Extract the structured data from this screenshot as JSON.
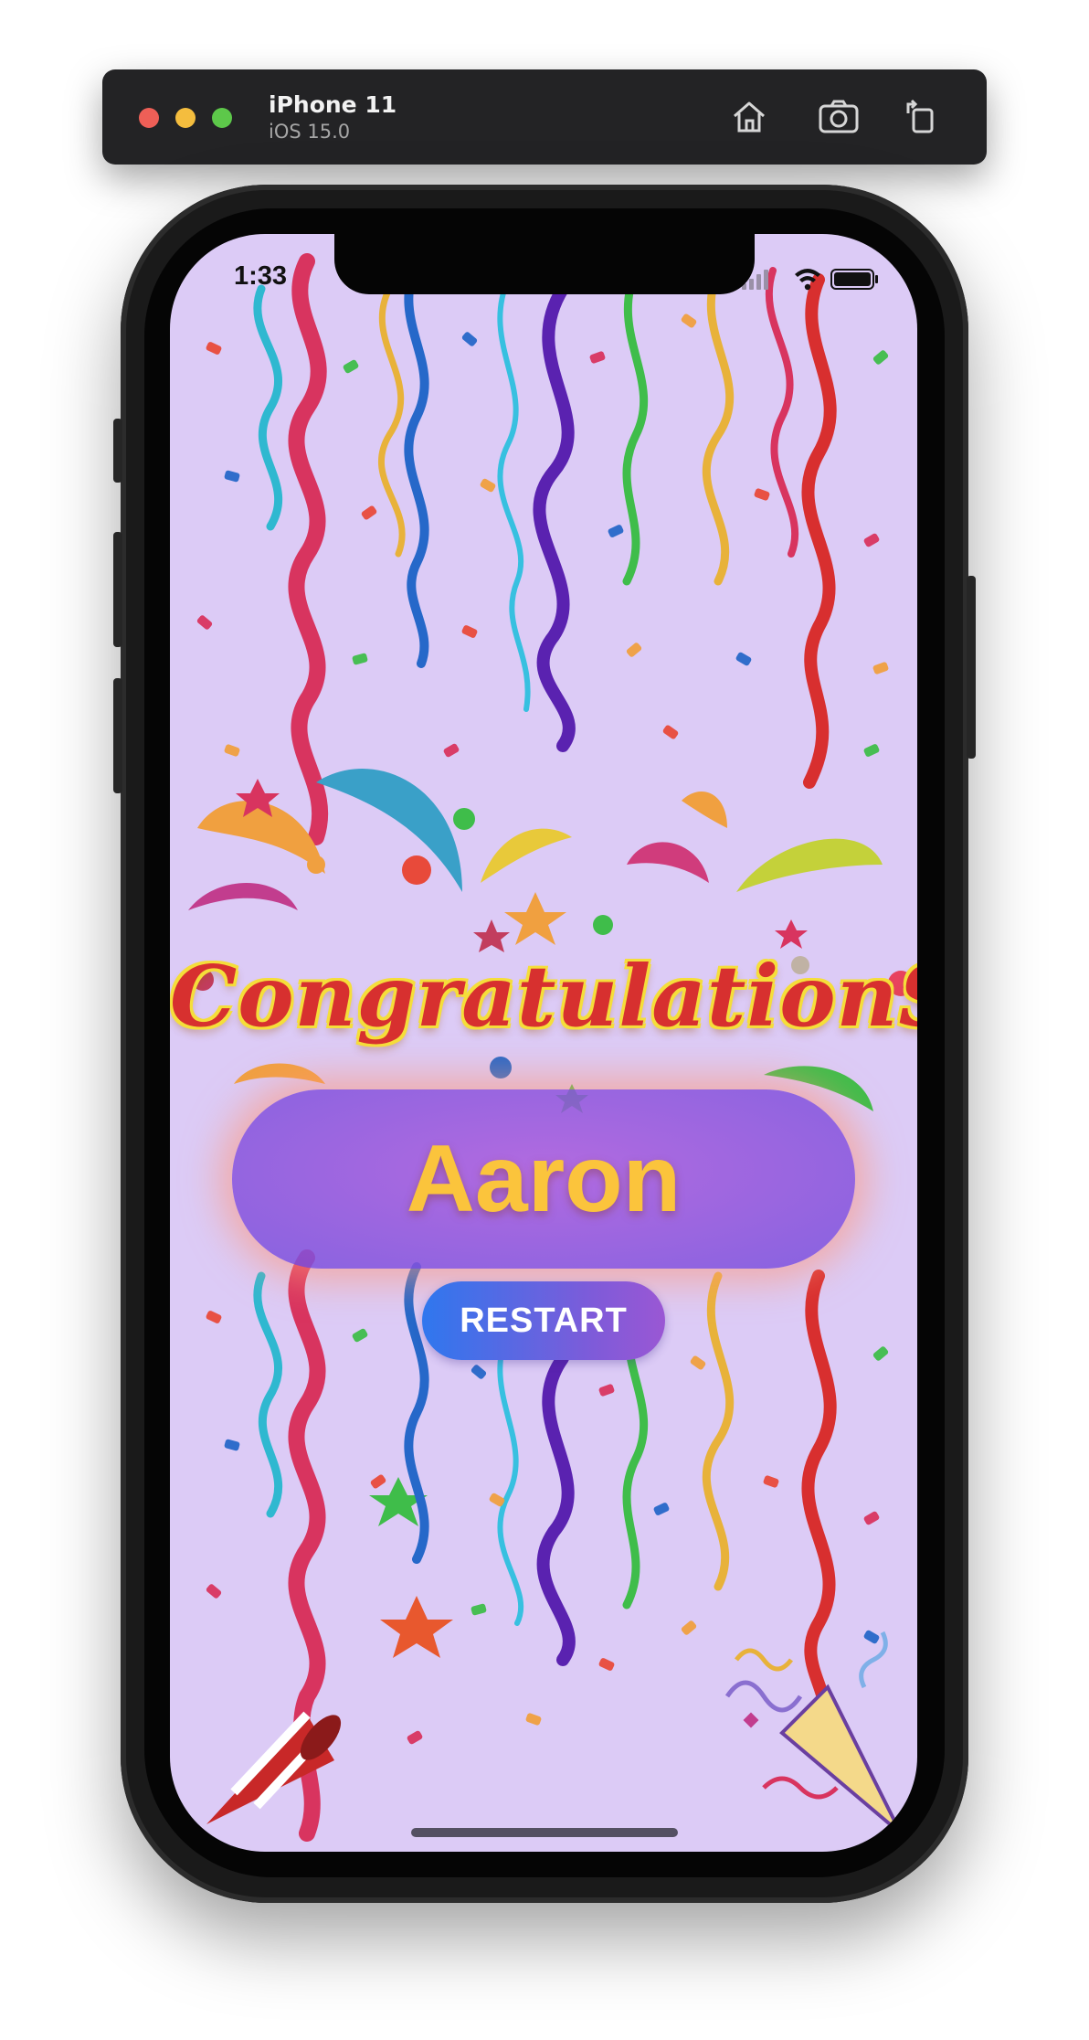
{
  "simulator": {
    "device_name": "iPhone 11",
    "os_version": "iOS 15.0",
    "icons": [
      "home-icon",
      "screenshot-icon",
      "rotate-icon"
    ]
  },
  "status_bar": {
    "time": "1:33",
    "icons": [
      "wifi-icon",
      "battery-icon"
    ]
  },
  "celebration": {
    "title": "CongratulationS",
    "name": "Aaron",
    "restart_label": "RESTART"
  },
  "colors": {
    "screen_background": "#dccbf6",
    "title_red": "#d7302f",
    "title_outline": "#f5de3a",
    "name_gold": "#fbc43c",
    "pill_purple": "#9a5ad8",
    "button_blue": "#2f77ee",
    "button_violet": "#9a57d4"
  }
}
